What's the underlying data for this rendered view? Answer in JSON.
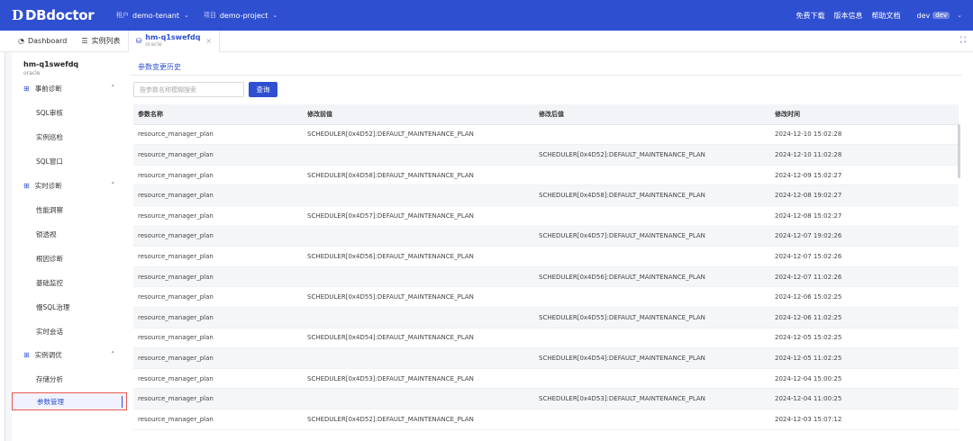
{
  "topbar": {
    "logo_mark": "D",
    "logo_text": "DBdoctor",
    "tenant_label": "租户",
    "tenant_value": "demo-tenant",
    "project_label": "项目",
    "project_value": "demo-project",
    "links": [
      "免费下载",
      "版本信息",
      "帮助文档"
    ],
    "user": "dev",
    "user_badge": "dev"
  },
  "tabs": [
    {
      "label": "Dashboard",
      "icon": "dashboard-icon"
    },
    {
      "label": "实例列表",
      "icon": "list-icon"
    },
    {
      "label": "hm-q1swefdq",
      "sub": "oracle",
      "icon": "database-icon",
      "active": true
    }
  ],
  "sidebar": {
    "db_name": "hm-q1swefdq",
    "db_type": "oracle",
    "groups": [
      {
        "label": "事前诊断",
        "items": [
          "SQL审核",
          "实例巡检",
          "SQL窗口"
        ]
      },
      {
        "label": "实时诊断",
        "items": [
          "性能洞察",
          "锁透视",
          "根因诊断",
          "基础监控",
          "慢SQL治理",
          "实时会话"
        ]
      },
      {
        "label": "实例调优",
        "items": [
          "存储分析",
          "参数管理"
        ]
      }
    ],
    "active_item": "参数管理"
  },
  "main": {
    "subtab": "参数变更历史",
    "search_placeholder": "按参数名称模糊搜索",
    "query_button": "查询",
    "columns": [
      "参数名称",
      "修改前值",
      "修改后值",
      "修改时间"
    ],
    "rows": [
      [
        "resource_manager_plan",
        "SCHEDULER[0x4D52]:DEFAULT_MAINTENANCE_PLAN",
        "",
        "2024-12-10 15:02:28"
      ],
      [
        "resource_manager_plan",
        "",
        "SCHEDULER[0x4D52]:DEFAULT_MAINTENANCE_PLAN",
        "2024-12-10 11:02:28"
      ],
      [
        "resource_manager_plan",
        "SCHEDULER[0x4D58]:DEFAULT_MAINTENANCE_PLAN",
        "",
        "2024-12-09 15:02:27"
      ],
      [
        "resource_manager_plan",
        "",
        "SCHEDULER[0x4D58]:DEFAULT_MAINTENANCE_PLAN",
        "2024-12-08 19:02:27"
      ],
      [
        "resource_manager_plan",
        "SCHEDULER[0x4D57]:DEFAULT_MAINTENANCE_PLAN",
        "",
        "2024-12-08 15:02:27"
      ],
      [
        "resource_manager_plan",
        "",
        "SCHEDULER[0x4D57]:DEFAULT_MAINTENANCE_PLAN",
        "2024-12-07 19:02:26"
      ],
      [
        "resource_manager_plan",
        "SCHEDULER[0x4D56]:DEFAULT_MAINTENANCE_PLAN",
        "",
        "2024-12-07 15:02:26"
      ],
      [
        "resource_manager_plan",
        "",
        "SCHEDULER[0x4D56]:DEFAULT_MAINTENANCE_PLAN",
        "2024-12-07 11:02:26"
      ],
      [
        "resource_manager_plan",
        "SCHEDULER[0x4D55]:DEFAULT_MAINTENANCE_PLAN",
        "",
        "2024-12-06 15:02:25"
      ],
      [
        "resource_manager_plan",
        "",
        "SCHEDULER[0x4D55]:DEFAULT_MAINTENANCE_PLAN",
        "2024-12-06 11:02:25"
      ],
      [
        "resource_manager_plan",
        "SCHEDULER[0x4D54]:DEFAULT_MAINTENANCE_PLAN",
        "",
        "2024-12-05 15:02:25"
      ],
      [
        "resource_manager_plan",
        "",
        "SCHEDULER[0x4D54]:DEFAULT_MAINTENANCE_PLAN",
        "2024-12-05 11:02:25"
      ],
      [
        "resource_manager_plan",
        "SCHEDULER[0x4D53]:DEFAULT_MAINTENANCE_PLAN",
        "",
        "2024-12-04 15:00:25"
      ],
      [
        "resource_manager_plan",
        "",
        "SCHEDULER[0x4D53]:DEFAULT_MAINTENANCE_PLAN",
        "2024-12-04 11:00:25"
      ],
      [
        "resource_manager_plan",
        "SCHEDULER[0x4D52]:DEFAULT_MAINTENANCE_PLAN",
        "",
        "2024-12-03 15:07:12"
      ]
    ]
  },
  "colors": {
    "brand": "#2f4fd1",
    "highlight": "#e8574d"
  }
}
